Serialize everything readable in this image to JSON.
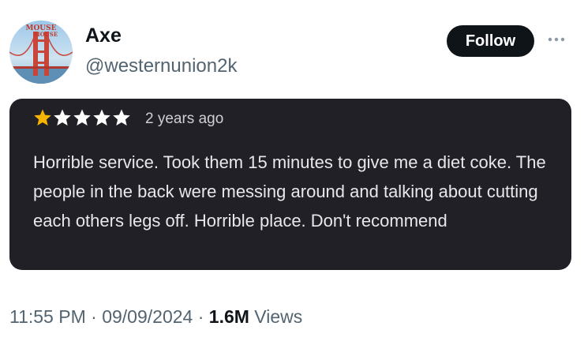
{
  "user": {
    "display_name": "Axe",
    "handle": "@westernunion2k",
    "avatar_icon": "golden-gate-bridge-avatar",
    "avatar_lettering": "MOUSE MOUSE"
  },
  "actions": {
    "follow_label": "Follow",
    "more_icon": "ellipsis-icon"
  },
  "review": {
    "rating": 1,
    "max_rating": 5,
    "time_ago": "2 years ago",
    "text": "Horrible service. Took them 15 minutes to give me a diet coke. The people in the back were messing around and talking about cutting each others legs off. Horrible place. Don't recommend",
    "star_filled_color": "#f4b400",
    "star_empty_color": "#ffffff",
    "card_color": "#212026"
  },
  "meta": {
    "time": "11:55 PM",
    "separator": " · ",
    "date": "09/09/2024",
    "views_count": "1.6M",
    "views_label": " Views"
  }
}
